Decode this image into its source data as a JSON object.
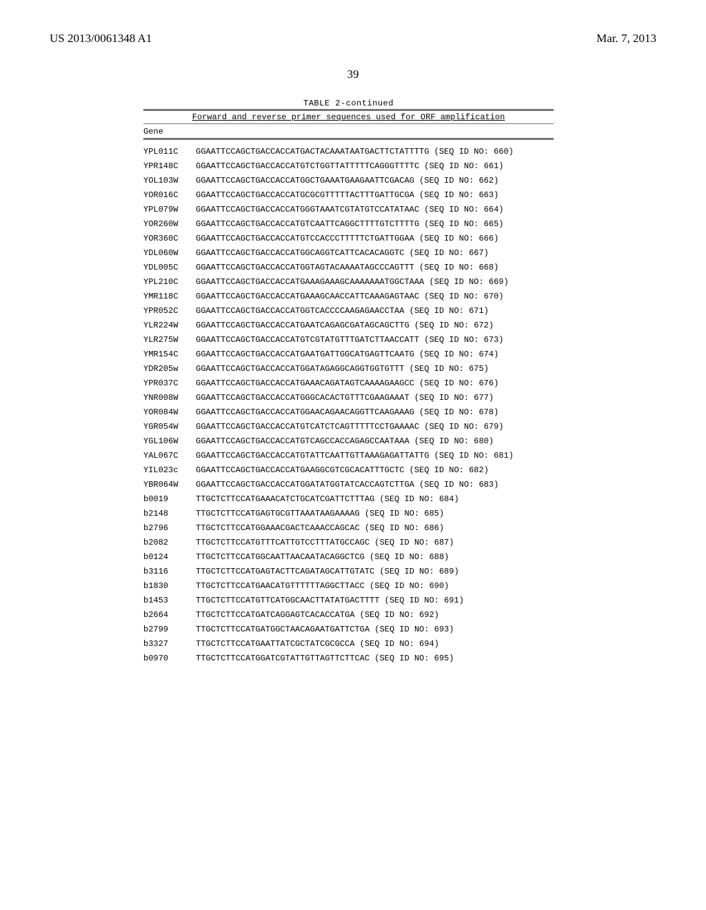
{
  "header": {
    "patent_no": "US 2013/0061348 A1",
    "date": "Mar. 7, 2013"
  },
  "page_number": "39",
  "table": {
    "title": "TABLE 2-continued",
    "caption": "Forward and reverse primer sequences used for ORF amplification",
    "col_head": "Gene",
    "rows": [
      {
        "gene": "YPL011C",
        "seq": "GGAATTCCAGCTGACCACCATGACTACAAATAATGACTTCTATTTTG (SEQ ID NO: 660)"
      },
      {
        "gene": "YPR148C",
        "seq": "GGAATTCCAGCTGACCACCATGTCTGGTTATTTTTCAGGGTTTTC (SEQ ID NO: 661)"
      },
      {
        "gene": "YOL103W",
        "seq": "GGAATTCCAGCTGACCACCATGGCTGAAATGAAGAATTCGACAG (SEQ ID NO: 662)"
      },
      {
        "gene": "YOR016C",
        "seq": "GGAATTCCAGCTGACCACCATGCGCGTTTTTACTTTGATTGCGA (SEQ ID NO: 663)"
      },
      {
        "gene": "YPL079W",
        "seq": "GGAATTCCAGCTGACCACCATGGGTAAATCGTATGTCCATATAAC (SEQ ID NO: 664)"
      },
      {
        "gene": "YOR260W",
        "seq": "GGAATTCCAGCTGACCACCATGTCAATTCAGGCTTTTGTCTTTTG (SEQ ID NO: 665)"
      },
      {
        "gene": "YOR360C",
        "seq": "GGAATTCCAGCTGACCACCATGTCCACCCTTTTTCTGATTGGAA (SEQ ID NO: 666)"
      },
      {
        "gene": "YDL060W",
        "seq": "GGAATTCCAGCTGACCACCATGGCAGGTCATTCACACAGGTC (SEQ ID NO: 667)"
      },
      {
        "gene": "YDL005C",
        "seq": "GGAATTCCAGCTGACCACCATGGTAGTACAAAATAGCCCAGTTT (SEQ ID NO: 668)"
      },
      {
        "gene": "YPL210C",
        "seq": "GGAATTCCAGCTGACCACCATGAAAGAAAGCAAAAAAATGGCTAAA (SEQ ID NO: 669)"
      },
      {
        "gene": "YMR118C",
        "seq": "GGAATTCCAGCTGACCACCATGAAAGCAACCATTCAAAGAGTAAC (SEQ ID NO: 670)"
      },
      {
        "gene": "YPR052C",
        "seq": "GGAATTCCAGCTGACCACCATGGTCACCCCAAGAGAACCTAA (SEQ ID NO: 671)"
      },
      {
        "gene": "YLR224W",
        "seq": "GGAATTCCAGCTGACCACCATGAATCAGAGCGATAGCAGCTTG (SEQ ID NO: 672)"
      },
      {
        "gene": "YLR275W",
        "seq": "GGAATTCCAGCTGACCACCATGTCGTATGTTTGATCTTAACCATT (SEQ ID NO: 673)"
      },
      {
        "gene": "YMR154C",
        "seq": "GGAATTCCAGCTGACCACCATGAATGATTGGCATGAGTTCAATG (SEQ ID NO: 674)"
      },
      {
        "gene": "YDR205w",
        "seq": "GGAATTCCAGCTGACCACCATGGATAGAGGCAGGTGGTGTTT (SEQ ID NO: 675)"
      },
      {
        "gene": "YPR037C",
        "seq": "GGAATTCCAGCTGACCACCATGAAACAGATAGTCAAAAGAAGCC (SEQ ID NO: 676)"
      },
      {
        "gene": "YNR008W",
        "seq": "GGAATTCCAGCTGACCACCATGGGCACACTGTTTCGAAGAAAT (SEQ ID NO: 677)"
      },
      {
        "gene": "YOR084W",
        "seq": "GGAATTCCAGCTGACCACCATGGAACAGAACAGGTTCAAGAAAG (SEQ ID NO: 678)"
      },
      {
        "gene": "YGR054W",
        "seq": "GGAATTCCAGCTGACCACCATGTCATCTCAGTTTTTCCTGAAAAC (SEQ ID NO: 679)"
      },
      {
        "gene": "YGL106W",
        "seq": "GGAATTCCAGCTGACCACCATGTCAGCCACCAGAGCCAATAAA (SEQ ID NO: 680)"
      },
      {
        "gene": "YAL067C",
        "seq": "GGAATTCCAGCTGACCACCATGTATTCAATTGTTAAAGAGATTATTG (SEQ ID NO: 681)"
      },
      {
        "gene": "YIL023c",
        "seq": "GGAATTCCAGCTGACCACCATGAAGGCGTCGCACATTTGCTC (SEQ ID NO: 682)"
      },
      {
        "gene": "YBR064W",
        "seq": "GGAATTCCAGCTGACCACCATGGATATGGTATCACCAGTCTTGA (SEQ ID NO: 683)"
      },
      {
        "gene": "b0019",
        "seq": "TTGCTCTTCCATGAAACATCTGCATCGATTCTTTAG (SEQ ID NO: 684)"
      },
      {
        "gene": "b2148",
        "seq": "TTGCTCTTCCATGAGTGCGTTAAATAAGAAAAG (SEQ ID NO: 685)"
      },
      {
        "gene": "b2796",
        "seq": "TTGCTCTTCCATGGAAACGACTCAAACCAGCAC (SEQ ID NO: 686)"
      },
      {
        "gene": "b2082",
        "seq": "TTGCTCTTCCATGTTTCATTGTCCTTTATGCCAGC (SEQ ID NO: 687)"
      },
      {
        "gene": "b0124",
        "seq": "TTGCTCTTCCATGGCAATTAACAATACAGGCTCG (SEQ ID NO: 688)"
      },
      {
        "gene": "b3116",
        "seq": "TTGCTCTTCCATGAGTACTTCAGATAGCATTGTATC (SEQ ID NO: 689)"
      },
      {
        "gene": "b1830",
        "seq": "TTGCTCTTCCATGAACATGTTTTTTAGGCTTACC (SEQ ID NO: 690)"
      },
      {
        "gene": "b1453",
        "seq": "TTGCTCTTCCATGTTCATGGCAACTTATATGACTTTT (SEQ ID NO: 691)"
      },
      {
        "gene": "b2664",
        "seq": "TTGCTCTTCCATGATCAGGAGTCACACCATGA (SEQ ID NO: 692)"
      },
      {
        "gene": "b2799",
        "seq": "TTGCTCTTCCATGATGGCTAACAGAATGATTCTGA (SEQ ID NO: 693)"
      },
      {
        "gene": "b3327",
        "seq": "TTGCTCTTCCATGAATTATCGCTATCGCGCCA (SEQ ID NO: 694)"
      },
      {
        "gene": "b0970",
        "seq": "TTGCTCTTCCATGGATCGTATTGTTAGTTCTTCAC (SEQ ID NO: 695)"
      }
    ]
  }
}
